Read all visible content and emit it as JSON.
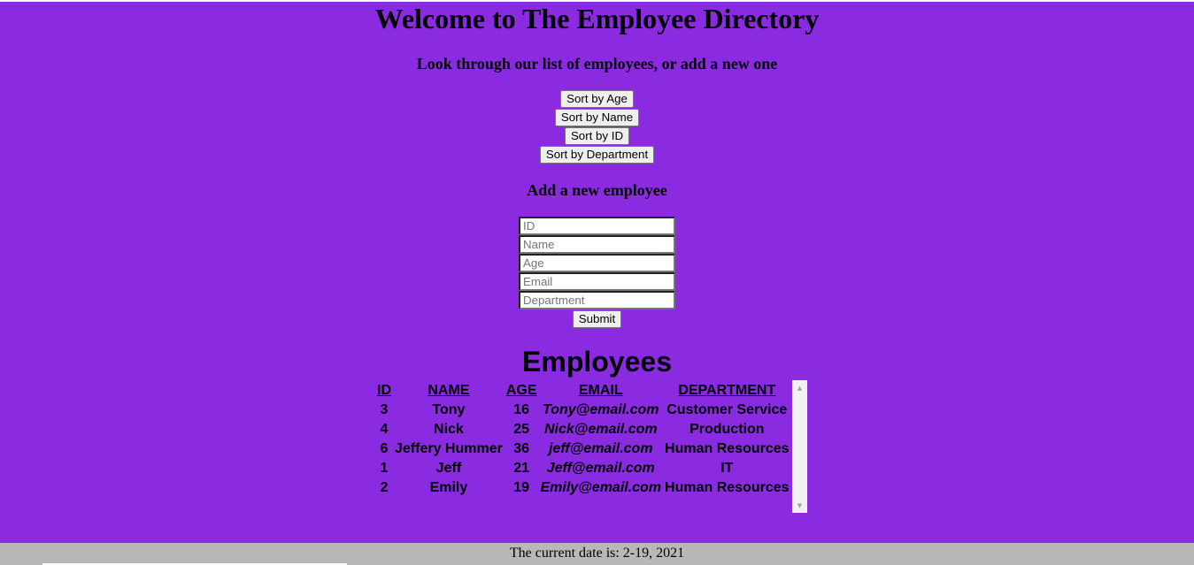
{
  "header": {
    "title": "Welcome to The Employee Directory",
    "subtitle": "Look through our list of employees, or add a new one"
  },
  "sort_buttons": {
    "age": "Sort by Age",
    "name": "Sort by Name",
    "id": "Sort by ID",
    "department": "Sort by Department"
  },
  "add_form": {
    "heading": "Add a new employee",
    "id_placeholder": "ID",
    "name_placeholder": "Name",
    "age_placeholder": "Age",
    "email_placeholder": "Email",
    "department_placeholder": "Department",
    "submit_label": "Submit"
  },
  "employees": {
    "heading": "Employees",
    "columns": [
      "ID",
      "NAME",
      "AGE",
      "EMAIL",
      "DEPARTMENT"
    ],
    "rows": [
      {
        "id": "3",
        "name": "Tony",
        "age": "16",
        "email": "Tony@email.com",
        "department": "Customer Service"
      },
      {
        "id": "4",
        "name": "Nick",
        "age": "25",
        "email": "Nick@email.com",
        "department": "Production"
      },
      {
        "id": "6",
        "name": "Jeffery Hummer",
        "age": "36",
        "email": "jeff@email.com",
        "department": "Human Resources"
      },
      {
        "id": "1",
        "name": "Jeff",
        "age": "21",
        "email": "Jeff@email.com",
        "department": "IT"
      },
      {
        "id": "2",
        "name": "Emily",
        "age": "19",
        "email": "Emily@email.com",
        "department": "Human Resources"
      }
    ]
  },
  "footer": {
    "date_text": "The current date is: 2-19, 2021"
  },
  "colors": {
    "background": "#8a2be2",
    "footer_background": "#b8b8b8"
  },
  "icons": {
    "scroll_up": "scroll-up-arrow-icon",
    "scroll_down": "scroll-down-arrow-icon"
  }
}
